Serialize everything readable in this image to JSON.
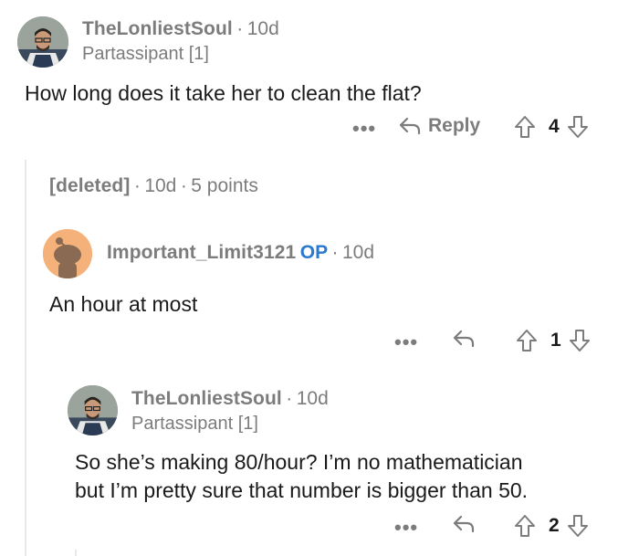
{
  "comments": [
    {
      "username": "TheLonliestSoul",
      "age": "10d",
      "flair": "Partassipant [1]",
      "body": "How long does it take her to clean the flat?",
      "reply_label": "Reply",
      "score": "4"
    },
    {
      "username": "[deleted]",
      "age": "10d",
      "points": "5 points"
    },
    {
      "username": "Important_Limit3121",
      "op_badge": "OP",
      "age": "10d",
      "body": "An hour at most",
      "score": "1"
    },
    {
      "username": "TheLonliestSoul",
      "age": "10d",
      "flair": "Partassipant [1]",
      "body_line1": "So she’s making 80/hour? I’m no mathematician",
      "body_line2": "but I’m pretty sure that number is bigger than 50.",
      "score": "2"
    }
  ],
  "separator": "·",
  "more_label": "•••",
  "colors": {
    "meta": "#7c7c7c",
    "op": "#2a7ad0",
    "snoo_bg": "#f4b27a"
  },
  "icons": [
    "more-icon",
    "reply-icon",
    "upvote-icon",
    "downvote-icon"
  ]
}
